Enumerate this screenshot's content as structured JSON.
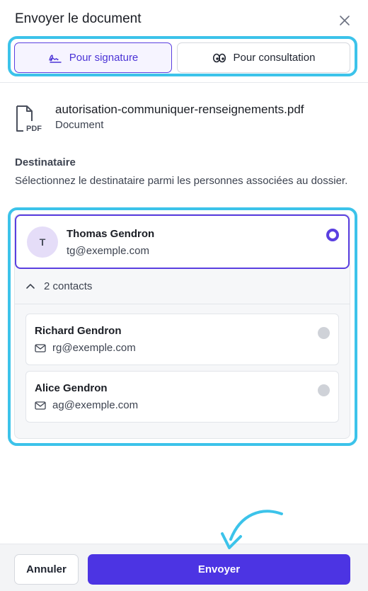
{
  "header": {
    "title": "Envoyer le document",
    "close_icon": "close-icon"
  },
  "tabs": [
    {
      "label": "Pour signature",
      "icon": "signature-icon",
      "selected": true
    },
    {
      "label": "Pour consultation",
      "icon": "eyes-icon",
      "selected": false
    }
  ],
  "document": {
    "icon": "pdf-file-icon",
    "icon_text": "PDF",
    "name": "autorisation-communiquer-renseignements.pdf",
    "type": "Document"
  },
  "recipient_section": {
    "label": "Destinataire",
    "description": "Sélectionnez le destinataire parmi les personnes associées au dossier."
  },
  "main_recipient": {
    "avatar_initial": "T",
    "name": "Thomas Gendron",
    "email": "tg@exemple.com",
    "selected": true
  },
  "contacts": {
    "toggle_label": "2 contacts",
    "expanded": true,
    "items": [
      {
        "name": "Richard Gendron",
        "email": "rg@exemple.com",
        "selected": false
      },
      {
        "name": "Alice Gendron",
        "email": "ag@exemple.com",
        "selected": false
      }
    ]
  },
  "footer": {
    "cancel_label": "Annuler",
    "send_label": "Envoyer"
  },
  "colors": {
    "accent": "#4c34e3",
    "highlight": "#3cc3ea",
    "avatar_bg": "#e5ddf8"
  }
}
